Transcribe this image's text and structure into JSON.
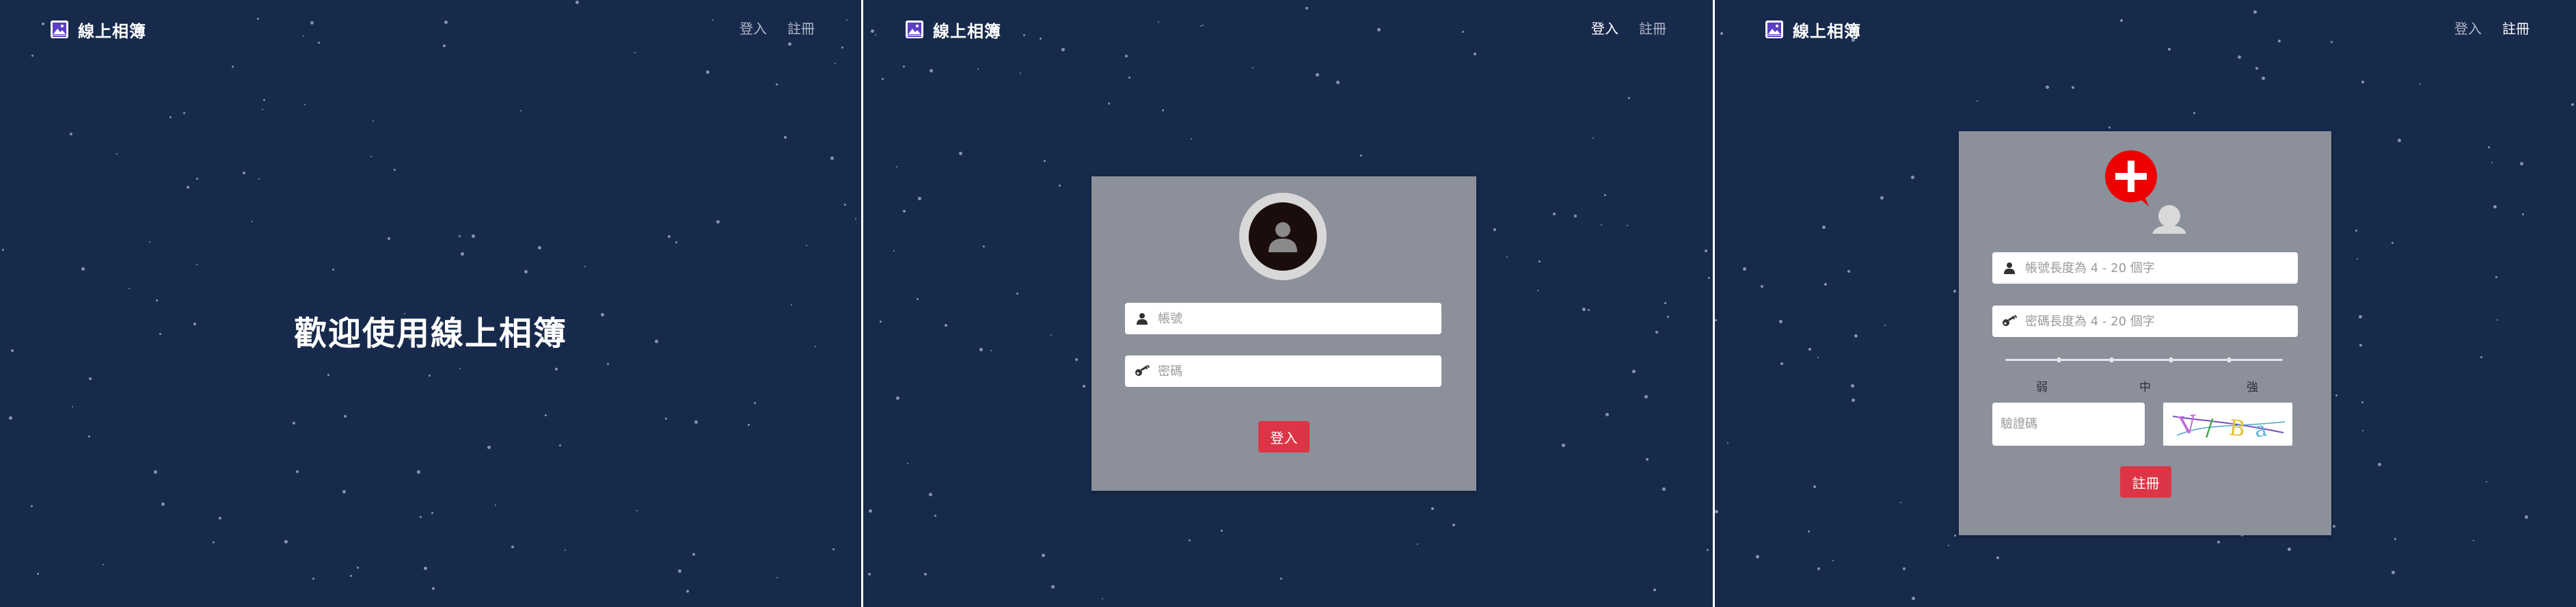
{
  "app": {
    "brand_name": "線上相簿",
    "nav_login": "登入",
    "nav_register": "註冊"
  },
  "welcome": {
    "headline": "歡迎使用線上相簿"
  },
  "login": {
    "account_placeholder": "帳號",
    "password_placeholder": "密碼",
    "submit_label": "登入"
  },
  "register": {
    "account_placeholder": "帳號長度為 4 - 20 個字",
    "password_placeholder": "密碼長度為 4 - 20 個字",
    "strength_labels": [
      "弱",
      "中",
      "強"
    ],
    "captcha_placeholder": "驗證碼",
    "submit_label": "註冊"
  },
  "colors": {
    "background": "#182a4c",
    "card": "#8b909b",
    "accent_red": "#dc3545",
    "badge_red": "#ee0000"
  }
}
